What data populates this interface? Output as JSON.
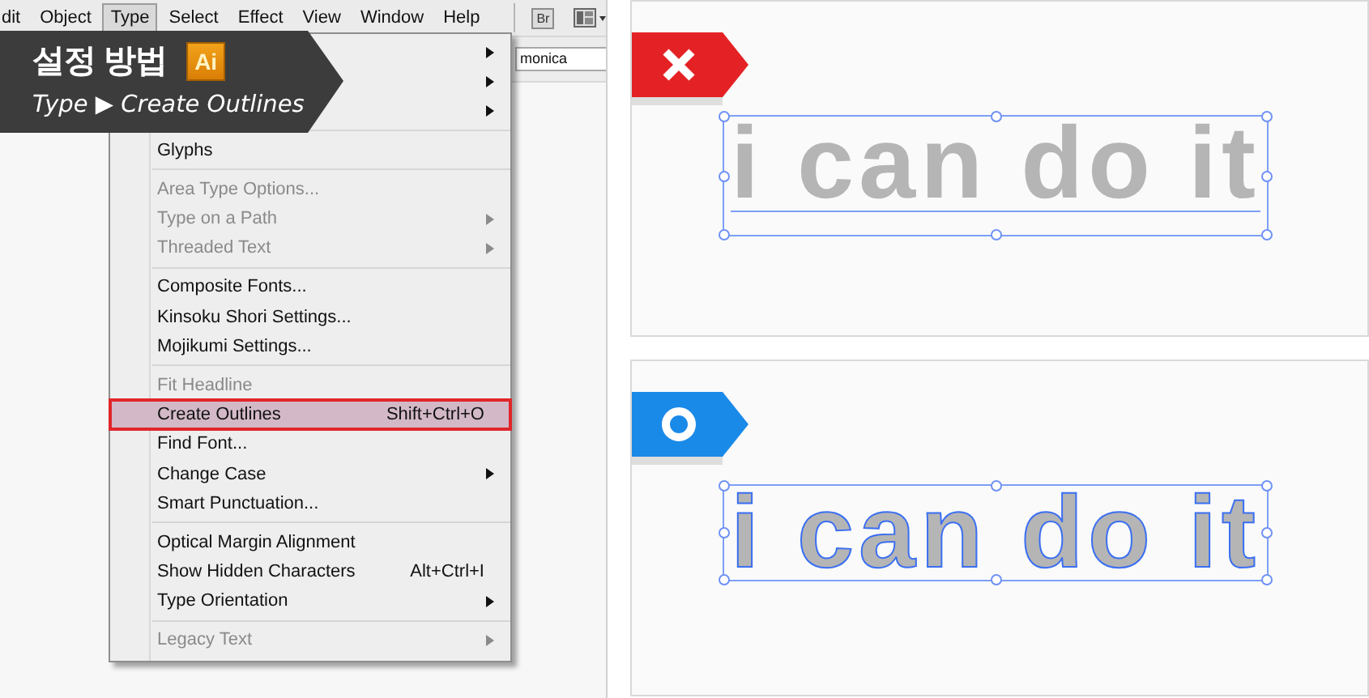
{
  "menubar": {
    "items": [
      {
        "label": "dit",
        "selected": false
      },
      {
        "label": "Object",
        "selected": false
      },
      {
        "label": "Type",
        "selected": true
      },
      {
        "label": "Select",
        "selected": false
      },
      {
        "label": "Effect",
        "selected": false
      },
      {
        "label": "View",
        "selected": false
      },
      {
        "label": "Window",
        "selected": false
      },
      {
        "label": "Help",
        "selected": false
      }
    ],
    "bridge_button": "Br"
  },
  "toolbar": {
    "font_field": {
      "value": "monica"
    }
  },
  "menu": {
    "items": [
      {
        "kind": "item",
        "submenu": true,
        "disabled": false,
        "selected": false
      },
      {
        "kind": "item",
        "submenu": true,
        "disabled": false,
        "selected": false
      },
      {
        "kind": "item",
        "submenu": true,
        "disabled": false,
        "selected": false
      },
      {
        "kind": "separator"
      },
      {
        "kind": "item",
        "label": "Glyphs",
        "submenu": false,
        "disabled": false,
        "selected": false
      },
      {
        "kind": "separator"
      },
      {
        "kind": "item",
        "label": "Area Type Options...",
        "submenu": false,
        "disabled": true,
        "selected": false
      },
      {
        "kind": "item",
        "label": "Type on a Path",
        "submenu": true,
        "disabled": true,
        "selected": false
      },
      {
        "kind": "item",
        "label": "Threaded Text",
        "submenu": true,
        "disabled": true,
        "selected": false
      },
      {
        "kind": "separator"
      },
      {
        "kind": "item",
        "label": "Composite Fonts...",
        "submenu": false,
        "disabled": false,
        "selected": false
      },
      {
        "kind": "item",
        "label": "Kinsoku Shori Settings...",
        "submenu": false,
        "disabled": false,
        "selected": false
      },
      {
        "kind": "item",
        "label": "Mojikumi Settings...",
        "submenu": false,
        "disabled": false,
        "selected": false
      },
      {
        "kind": "separator"
      },
      {
        "kind": "item",
        "label": "Fit Headline",
        "submenu": false,
        "disabled": true,
        "selected": false
      },
      {
        "kind": "item",
        "label": "Create Outlines",
        "shortcut": "Shift+Ctrl+O",
        "submenu": false,
        "disabled": false,
        "selected": true
      },
      {
        "kind": "item",
        "label": "Find Font...",
        "submenu": false,
        "disabled": false,
        "selected": false
      },
      {
        "kind": "item",
        "label": "Change Case",
        "submenu": true,
        "disabled": false,
        "selected": false
      },
      {
        "kind": "item",
        "label": "Smart Punctuation...",
        "submenu": false,
        "disabled": false,
        "selected": false
      },
      {
        "kind": "separator"
      },
      {
        "kind": "item",
        "label": "Optical Margin Alignment",
        "submenu": false,
        "disabled": false,
        "selected": false
      },
      {
        "kind": "item",
        "label": "Show Hidden Characters",
        "shortcut": "Alt+Ctrl+I",
        "submenu": false,
        "disabled": false,
        "selected": false
      },
      {
        "kind": "item",
        "label": "Type Orientation",
        "submenu": true,
        "disabled": false,
        "selected": false
      },
      {
        "kind": "separator"
      },
      {
        "kind": "item",
        "label": "Legacy Text",
        "submenu": true,
        "disabled": true,
        "selected": false
      }
    ]
  },
  "banner": {
    "title": "설정 방법",
    "logo": "Ai",
    "path": "Type ▶ Create Outlines"
  },
  "examples": [
    {
      "kind": "wrong",
      "artwork_text": "i can do it",
      "outlined": false
    },
    {
      "kind": "right",
      "artwork_text": "i can do it",
      "outlined": true
    }
  ]
}
